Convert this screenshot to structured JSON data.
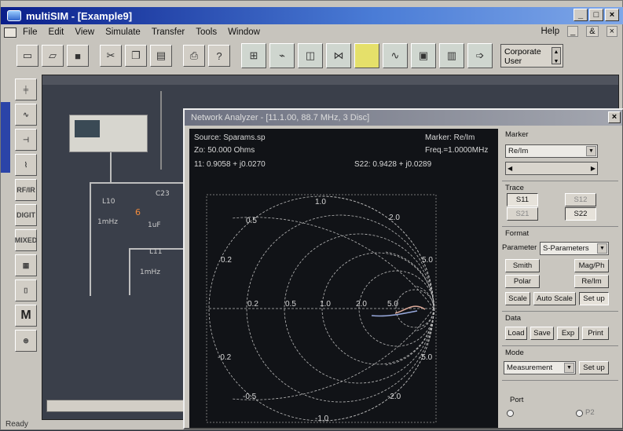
{
  "window": {
    "title": "multiSIM - [Example9]",
    "min": "_",
    "max": "□",
    "close": "×"
  },
  "menu": {
    "items": [
      "File",
      "Edit",
      "View",
      "Simulate",
      "Transfer",
      "Tools",
      "Window"
    ],
    "help": "Help",
    "doc_min": "_",
    "doc_restore": "&",
    "doc_close": "×"
  },
  "toolbar": {
    "user_line1": "Corporate",
    "user_line2": "User"
  },
  "components": [
    "",
    "",
    "",
    "",
    "RF/IR",
    "DIGIT",
    "MIXED",
    "",
    "",
    "M",
    ""
  ],
  "schematic": {
    "l10": "L10",
    "l10_val": "1mHz",
    "node": "6",
    "c23": "C23",
    "c23_val": "1uF",
    "l11": "L11",
    "l11_val": "1mHz"
  },
  "analyzer": {
    "title": "Network Analyzer - [11.1.00, 88.7 MHz, 3 Disc]",
    "source": "Source: Sparams.sp",
    "marker_text": "Marker: Re/Im",
    "z0": "Zo: 50.000 Ohms",
    "freq": "Freq.=1.0000MHz",
    "s11": "11: 0.9058 + j0.0270",
    "s22": "S22: 0.9428 + j0.0289",
    "smith_labels": [
      "1.0",
      "2.0",
      "0.5",
      "0.2",
      "5.0",
      "0.2",
      "0.5",
      "1.0",
      "2.0",
      "5.0",
      "-0.2",
      "-5.0",
      "-0.5",
      "-2.0",
      "-1.0"
    ]
  },
  "panel": {
    "marker_label": "Marker",
    "marker_select": "Re/Im",
    "trace_label": "Trace",
    "trace_s11": "S11",
    "trace_s21": "S21",
    "trace_s12": "S12",
    "trace_s22": "S22",
    "format_label": "Format",
    "parameter_label": "Parameter",
    "parameter_select": "S-Parameters",
    "btn_smith": "Smith",
    "btn_magph": "Mag/Ph",
    "btn_polar": "Polar",
    "btn_reim": "Re/Im",
    "btn_scale": "Scale",
    "btn_autoscale": "Auto Scale",
    "btn_setup": "Set up",
    "data_label": "Data",
    "btn_load": "Load",
    "btn_save": "Save",
    "btn_exp": "Exp",
    "btn_print": "Print",
    "mode_label": "Mode",
    "mode_select": "Measurement",
    "btn_mode_setup": "Set up",
    "port_label": "Port",
    "port_p2": "P2"
  },
  "status": {
    "text": "Ready"
  }
}
